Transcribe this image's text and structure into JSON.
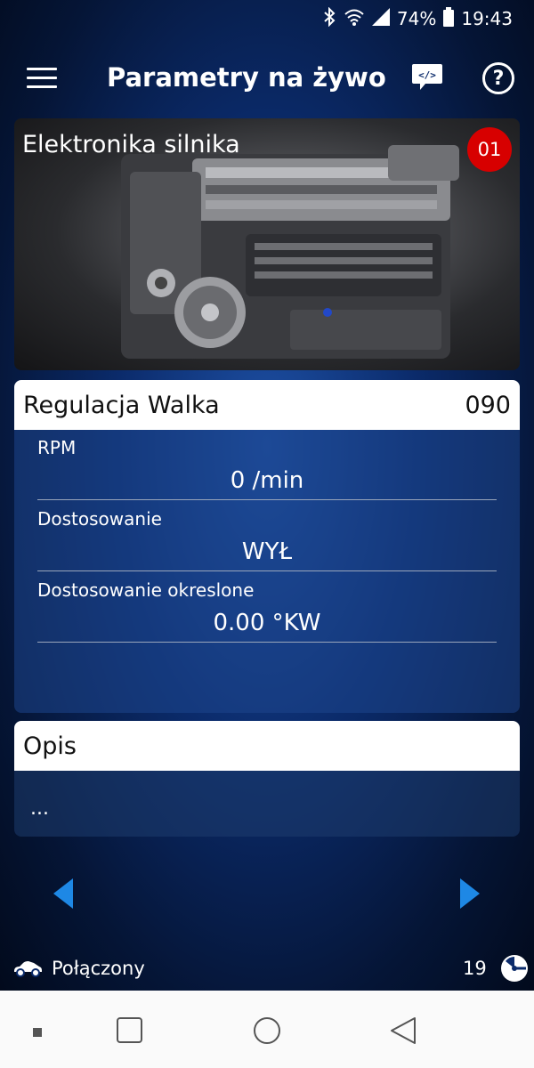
{
  "status_bar": {
    "battery": "74%",
    "time": "19:43",
    "icons": [
      "bluetooth-icon",
      "wifi-icon",
      "signal-icon",
      "battery-icon"
    ]
  },
  "app_bar": {
    "title": "Parametry na żywo",
    "icons": [
      "menu-icon",
      "code-chat-icon",
      "help-icon"
    ]
  },
  "ecu": {
    "name": "Elektronika silnika",
    "badge": "01"
  },
  "group": {
    "name": "Regulacja Walka",
    "number": "090"
  },
  "parameters": [
    {
      "name": "RPM",
      "value": "0 /min"
    },
    {
      "name": "Dostosowanie",
      "value": "WYŁ"
    },
    {
      "name": "Dostosowanie okreslone",
      "value": "0.00 °KW"
    }
  ],
  "description": {
    "header": "Opis",
    "text": "..."
  },
  "footer": {
    "connection": "Połączony",
    "count": "19"
  },
  "colors": {
    "accent_blue": "#1e88e5",
    "badge_red": "#d70000",
    "background": "#0b2b6b"
  }
}
